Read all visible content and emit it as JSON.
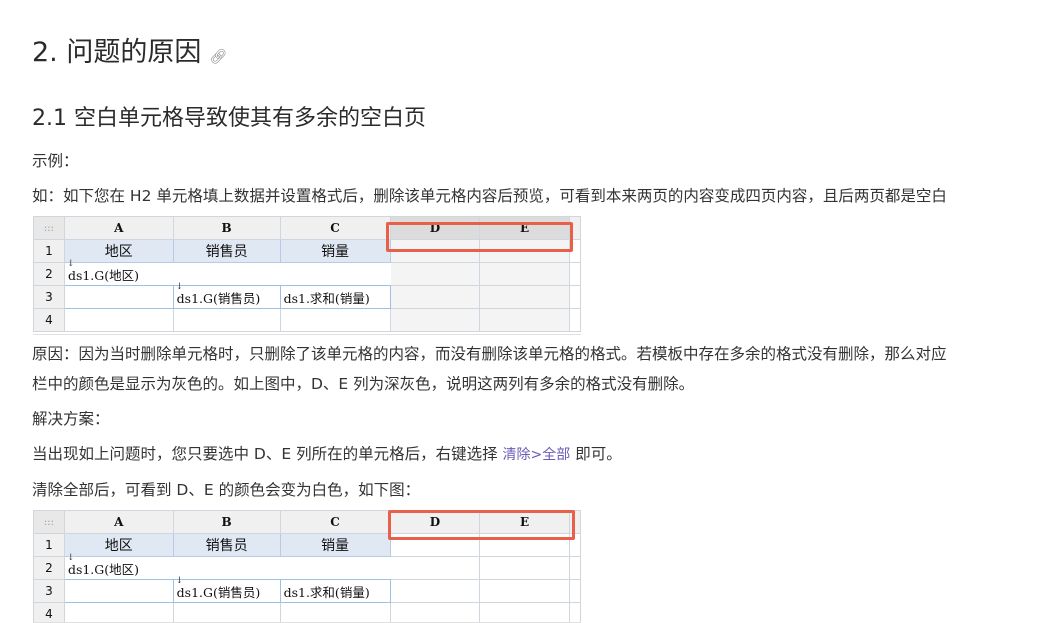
{
  "heading": {
    "title": "2. 问题的原因",
    "anchor_icon": "link-icon"
  },
  "subheading": "2.1 空白单元格导致使其有多余的空白页",
  "label_example": "示例：",
  "intro": "如：如下您在 H2 单元格填上数据并设置格式后，删除该单元格内容后预览，可看到本来两页的内容变成四页内容，且后两页都是空白",
  "cause_line1": "原因：因为当时删除单元格时，只删除了该单元格的内容，而没有删除该单元格的格式。若模板中存在多余的格式没有删除，那么对应",
  "cause_line2": "栏中的颜色是显示为灰色的。如上图中，D、E 列为深灰色，说明这两列有多余的格式没有删除。",
  "label_solution": "解决方案：",
  "solution_before": "当出现如上问题时，您只要选中 D、E 列所在的单元格后，右键选择",
  "solution_link": "清除>全部",
  "solution_after": "即可。",
  "after_clear": "清除全部后，可看到 D、E 的颜色会变为白色，如下图：",
  "sheet": {
    "corner": ":::",
    "columns": [
      "A",
      "B",
      "C",
      "D",
      "E"
    ],
    "rows": [
      "1",
      "2",
      "3",
      "4"
    ],
    "r1": {
      "a": "地区",
      "b": "销售员",
      "c": "销量"
    },
    "r2": {
      "a": "ds1.G(地区)"
    },
    "r3": {
      "b": "ds1.G(销售员)",
      "c": "ds1.求和(销量)"
    }
  },
  "colors": {
    "highlight": "#e8604a",
    "title_cell": "#dfe8f3",
    "link": "#6b5ab8"
  }
}
